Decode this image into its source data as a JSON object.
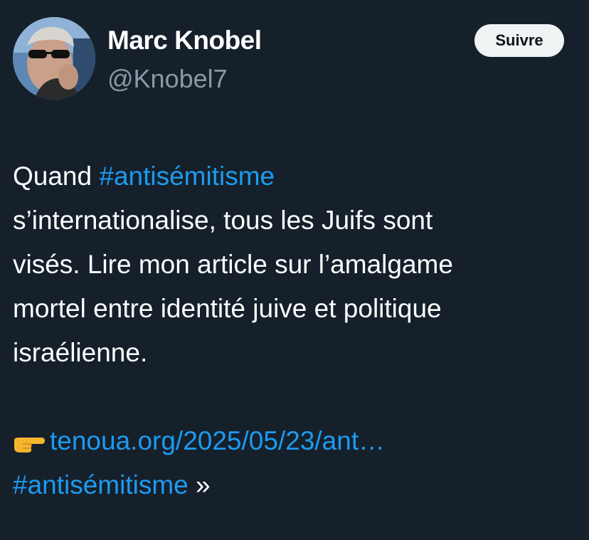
{
  "author": {
    "display_name": "Marc Knobel",
    "handle": "@Knobel7",
    "avatar_icon": "profile-photo"
  },
  "follow_button": {
    "label": "Suivre"
  },
  "tweet": {
    "line1_prefix": "Quand ",
    "hashtag1": "#antisémitisme",
    "line2": "s’internationalise, tous les Juifs sont",
    "line3": "visés. Lire mon article sur l’amalgame",
    "line4": "mortel entre identité juive et politique",
    "line5": "israélienne.",
    "pointer_icon": "backhand-index-pointing-right-emoji",
    "link": "tenoua.org/2025/05/23/ant…",
    "hashtag2": "#antisémitisme",
    "closing": " »"
  },
  "colors": {
    "background": "#15202b",
    "text": "#ffffff",
    "secondary_text": "#8b98a5",
    "accent": "#1d9bf0",
    "button_bg": "#eff3f4"
  }
}
